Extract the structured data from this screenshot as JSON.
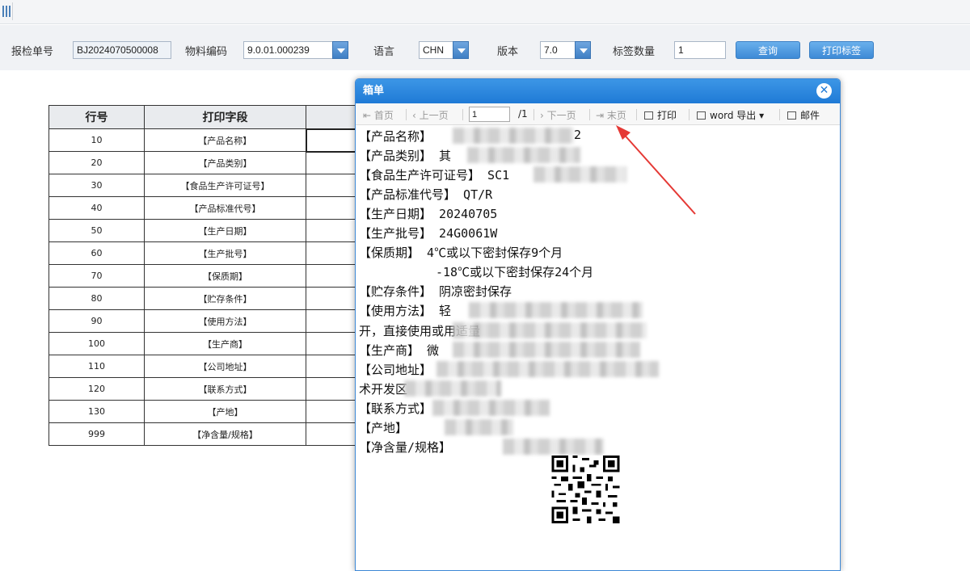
{
  "filters": {
    "inspection_no_label": "报检单号",
    "inspection_no_value": "BJ2024070500008",
    "material_code_label": "物料编码",
    "material_code_value": "9.0.01.000239",
    "language_label": "语言",
    "language_value": "CHN",
    "version_label": "版本",
    "version_value": "7.0",
    "label_qty_label": "标签数量",
    "label_qty_value": "1",
    "query_button": "查询",
    "print_button": "打印标签"
  },
  "table": {
    "headers": [
      "行号",
      "打印字段"
    ],
    "rows": [
      {
        "no": "10",
        "field": "【产品名称】"
      },
      {
        "no": "20",
        "field": "【产品类别】"
      },
      {
        "no": "30",
        "field": "【食品生产许可证号】"
      },
      {
        "no": "40",
        "field": "【产品标准代号】"
      },
      {
        "no": "50",
        "field": "【生产日期】"
      },
      {
        "no": "60",
        "field": "【生产批号】"
      },
      {
        "no": "70",
        "field": "【保质期】"
      },
      {
        "no": "80",
        "field": "【贮存条件】"
      },
      {
        "no": "90",
        "field": "【使用方法】"
      },
      {
        "no": "100",
        "field": "【生产商】"
      },
      {
        "no": "110",
        "field": "【公司地址】"
      },
      {
        "no": "120",
        "field": "【联系方式】"
      },
      {
        "no": "130",
        "field": "【产地】"
      },
      {
        "no": "999",
        "field": "【净含量/规格】"
      }
    ]
  },
  "dialog": {
    "title": "箱单",
    "close_icon": "close-circle-icon",
    "toolbar": {
      "first": "首页",
      "prev": "上一页",
      "page_value": "1",
      "page_total": "/1",
      "next": "下一页",
      "last": "末页",
      "print": "打印",
      "word_export": "word 导出",
      "mail": "邮件"
    },
    "label_lines": {
      "product_name": "【产品名称】",
      "product_name_tail": "2",
      "category": "【产品类别】",
      "category_value": "其",
      "license": "【食品生产许可证号】",
      "license_value": "SC1",
      "standard": "【产品标准代号】",
      "standard_value": "QT/R",
      "prod_date": "【生产日期】",
      "prod_date_value": "20240705",
      "batch": "【生产批号】",
      "batch_value": "24G0061W",
      "shelf_life": "【保质期】",
      "shelf_life_value1": "4℃或以下密封保存9个月",
      "shelf_life_value2": "-18℃或以下密封保存24个月",
      "storage": "【贮存条件】",
      "storage_value": "阴凉密封保存",
      "usage": "【使用方法】",
      "usage_value": "轻",
      "usage_line2": "开，直接使用或用适量",
      "manufacturer": "【生产商】",
      "manufacturer_value": "微",
      "address": "【公司地址】",
      "address_value": "江苏省苏州市吴江",
      "address_line2": "术开发区",
      "contact": "【联系方式】",
      "origin": "【产地】",
      "origin_value": "江苏省苏州市",
      "net": "【净含量/规格】",
      "net_value": "1000g"
    }
  }
}
